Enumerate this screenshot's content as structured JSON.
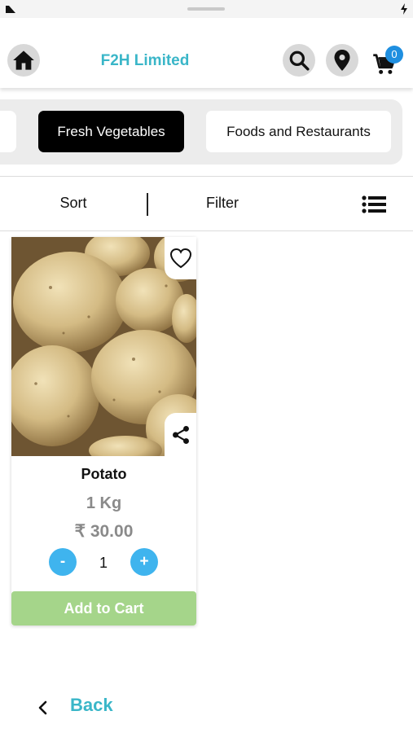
{
  "header": {
    "brand": "F2H Limited",
    "cart_count": "0",
    "icons": [
      "home-icon",
      "search-icon",
      "location-pin-icon",
      "cart-icon"
    ]
  },
  "categories": [
    {
      "label": "Fresh Vegetables",
      "active": true
    },
    {
      "label": "Foods and Restaurants",
      "active": false
    }
  ],
  "toolbar": {
    "sort_label": "Sort",
    "filter_label": "Filter",
    "view_icon": "list-view-icon"
  },
  "product": {
    "name": "Potato",
    "quantity": "1 Kg",
    "price": "₹ 30.00",
    "minus_label": "-",
    "plus_label": "+",
    "count": "1",
    "add_to_cart_label": "Add to Cart",
    "icons": [
      "heart-icon",
      "share-icon"
    ]
  },
  "footer": {
    "back_label": "Back"
  },
  "colors": {
    "brand": "#3ab6c8",
    "badge": "#1f8fe0",
    "stepper": "#3fb4ee",
    "add_to_cart": "#a5d58a",
    "active_chip": "#000000"
  }
}
